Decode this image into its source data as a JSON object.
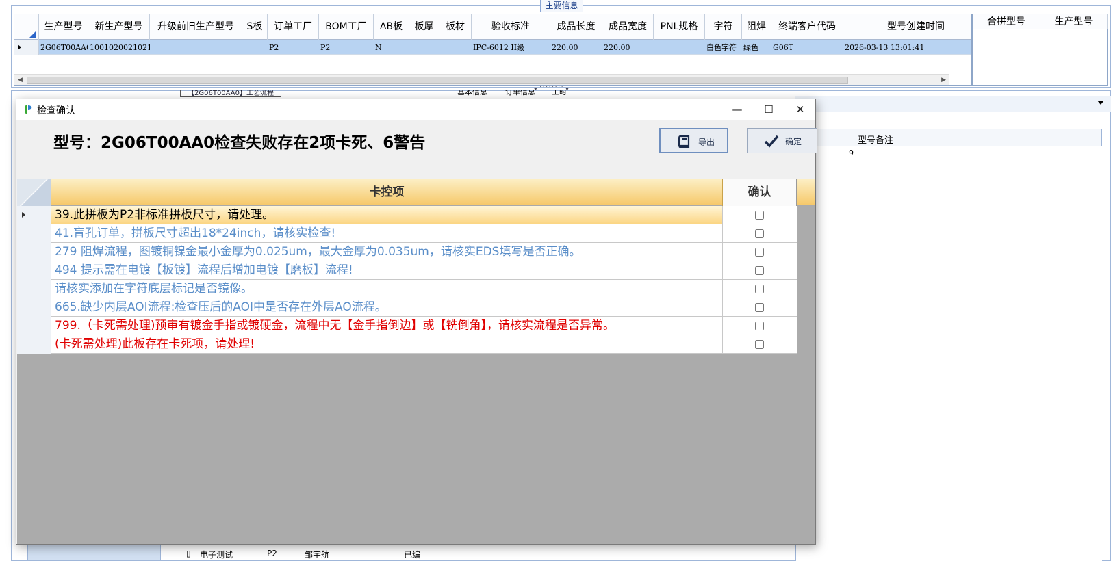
{
  "background": {
    "main_info_tab": "主要信息",
    "grid": {
      "columns": [
        {
          "label": "生产型号"
        },
        {
          "label": "新生产型号"
        },
        {
          "label": "升级前旧生产型号"
        },
        {
          "label": "S板"
        },
        {
          "label": "订单工厂"
        },
        {
          "label": "BOM工厂"
        },
        {
          "label": "AB板"
        },
        {
          "label": "板厚"
        },
        {
          "label": "板材"
        },
        {
          "label": "验收标准"
        },
        {
          "label": "成品长度"
        },
        {
          "label": "成品宽度"
        },
        {
          "label": "PNL规格"
        },
        {
          "label": "字符"
        },
        {
          "label": "阻焊"
        },
        {
          "label": "终端客户代码"
        },
        {
          "label": "型号创建时间"
        }
      ],
      "row": [
        "2G06T00AA0",
        "10010200210215",
        "",
        "",
        "P2",
        "P2",
        "N",
        "",
        "",
        "IPC-6012 II级",
        "220.00",
        "220.00",
        "",
        "白色字符",
        "绿色",
        "G06T",
        "2026-03-13 13:01:41"
      ]
    },
    "side_columns": [
      "合拼型号",
      "生产型号"
    ],
    "craft_tag": "【2G06T00AA0】工艺流程",
    "mid_tabs": [
      "基本信息",
      "订单信息",
      "工时"
    ],
    "right_panel_label": "型号备注",
    "right_panel_value": "9",
    "tree_row": {
      "name": "电子测试",
      "factory": "P2",
      "person": "邹宇航",
      "status": "已编"
    }
  },
  "dialog": {
    "title": "检查确认",
    "heading": "型号：2G06T00AA0检查失败存在2项卡死、6警告",
    "export_button": "导出",
    "ok_button": "确定",
    "grid": {
      "col_item": "卡控项",
      "col_confirm": "确认",
      "rows": [
        {
          "text": "39.此拼板为P2非标准拼板尺寸，请处理。",
          "level": "normal",
          "checked": false,
          "selected": true
        },
        {
          "text": "41.盲孔订单，拼板尺寸超出18*24inch，请核实检查!",
          "level": "warn",
          "checked": false,
          "selected": false
        },
        {
          "text": "279 阻焊流程，图镀铜镍金最小金厚为0.025um，最大金厚为0.035um，请核实EDS填写是否正确。",
          "level": "warn",
          "checked": false,
          "selected": false
        },
        {
          "text": "494 提示需在电镀【板镀】流程后增加电镀【磨板】流程!",
          "level": "warn",
          "checked": false,
          "selected": false
        },
        {
          "text": "请核实添加在字符底层标记是否镜像。",
          "level": "warn",
          "checked": false,
          "selected": false
        },
        {
          "text": "665.缺少内层AOI流程:检查压后的AOI中是否存在外层AO流程。",
          "level": "warn",
          "checked": false,
          "selected": false
        },
        {
          "text": "799.（卡死需处理)预审有镀金手指或镀硬金，流程中无【金手指倒边】或【铣倒角】，请核实流程是否异常。",
          "level": "fatal",
          "checked": false,
          "selected": false
        },
        {
          "text": "(卡死需处理)此板存在卡死项，请处理!",
          "level": "fatal",
          "checked": false,
          "selected": false
        }
      ]
    }
  }
}
